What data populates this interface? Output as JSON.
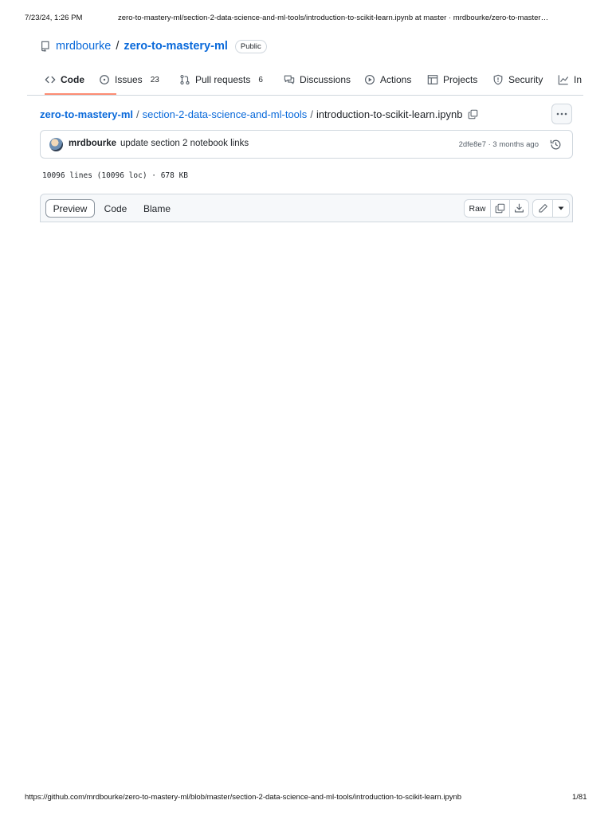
{
  "print_header": {
    "datetime": "7/23/24, 1:26 PM",
    "title": "zero-to-mastery-ml/section-2-data-science-and-ml-tools/introduction-to-scikit-learn.ipynb at master · mrdbourke/zero-to-master…"
  },
  "repo": {
    "owner": "mrdbourke",
    "separator": "/",
    "name": "zero-to-mastery-ml",
    "visibility": "Public"
  },
  "tabs": [
    {
      "label": "Code",
      "icon": "code-icon",
      "active": true
    },
    {
      "label": "Issues",
      "count": "23",
      "icon": "issue-icon"
    },
    {
      "label": "Pull requests",
      "count": "6",
      "icon": "pull-request-icon"
    },
    {
      "label": "Discussions",
      "icon": "discussion-icon"
    },
    {
      "label": "Actions",
      "icon": "play-icon"
    },
    {
      "label": "Projects",
      "icon": "table-icon"
    },
    {
      "label": "Security",
      "icon": "shield-icon"
    },
    {
      "label": "In",
      "icon": "graph-icon"
    }
  ],
  "breadcrumb": {
    "root": "zero-to-mastery-ml",
    "folder": "section-2-data-science-and-ml-tools",
    "file": "introduction-to-scikit-learn.ipynb",
    "separator": "/"
  },
  "commit": {
    "author": "mrdbourke",
    "message": "update section 2 notebook links",
    "meta": "2dfe8e7 · 3 months ago"
  },
  "file_stats": "10096 lines (10096 loc) · 678 KB",
  "file_view": {
    "tabs": [
      "Preview",
      "Code",
      "Blame"
    ],
    "raw_label": "Raw"
  },
  "print_footer": {
    "url": "https://github.com/mrdbourke/zero-to-mastery-ml/blob/master/section-2-data-science-and-ml-tools/introduction-to-scikit-learn.ipynb",
    "page": "1/81"
  },
  "colors": {
    "link": "#0969da",
    "text": "#1f2328",
    "border": "#d0d7de",
    "active_tab_underline": "#fd8c73"
  }
}
